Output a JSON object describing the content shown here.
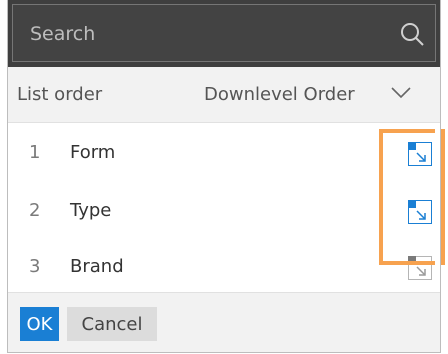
{
  "search": {
    "placeholder": "Search",
    "icon": "search-icon"
  },
  "header": {
    "list_order_label": "List order",
    "downlevel_label": "Downlevel Order",
    "dropdown_icon": "chevron-down-icon"
  },
  "rows": [
    {
      "index": "1",
      "label": "Form",
      "icon": "downlevel-order-icon",
      "state": "active"
    },
    {
      "index": "2",
      "label": "Type",
      "icon": "downlevel-order-icon",
      "state": "active"
    },
    {
      "index": "3",
      "label": "Brand",
      "icon": "downlevel-order-icon",
      "state": "inactive"
    }
  ],
  "footer": {
    "ok_label": "OK",
    "cancel_label": "Cancel"
  },
  "colors": {
    "search_bg": "#3f3f3f",
    "accent_blue": "#1a7fd4",
    "highlight_orange": "#f7a24f",
    "inactive_gray": "#9a9a9a"
  }
}
